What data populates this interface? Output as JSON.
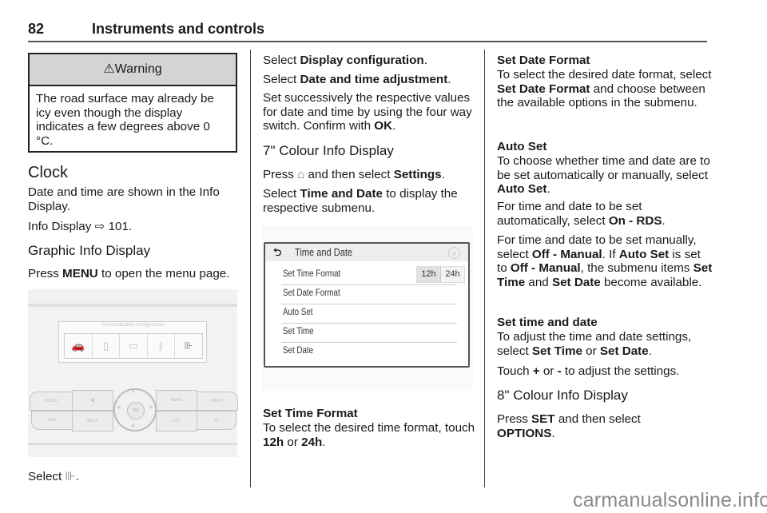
{
  "header": {
    "page_number": "82",
    "section_title": "Instruments and controls"
  },
  "warning": {
    "icon": "warning-triangle-icon",
    "icon_glyph": "⚠",
    "title": "Warning",
    "text": "The road surface may already be icy even though the display indicates a few degrees above 0 °C."
  },
  "col1": {
    "clock_heading": "Clock",
    "clock_text": "Date and time are shown in the Info Display.",
    "ref_prefix": "Info Display",
    "ref_arrow": "⇨",
    "ref_page": "101.",
    "graphic_heading": "Graphic Info Display",
    "press_prefix": "Press ",
    "press_bold": "MENU",
    "press_suffix": " to open the menu page.",
    "select_prefix": "Select ",
    "select_icon_glyph": "⊪",
    "select_suffix": "."
  },
  "panel_illustration": {
    "screen_title": "Personalisation-configuration",
    "icons": [
      "car-settings-icon",
      "phone-icon",
      "media-icon",
      "bluetooth-icon",
      "config-sliders-icon"
    ],
    "icon_glyphs": [
      "🚗",
      "▯",
      "▭",
      "ᛒ",
      "⊪"
    ],
    "buttons": {
      "audio": "AUDIO",
      "phone": "▣",
      "menu": "MENU",
      "band": "BAND",
      "src": "SRC",
      "back": "BACK",
      "list": "LIST",
      "ta": "TA",
      "ok": "OK"
    }
  },
  "col2": {
    "p1_prefix": "Select ",
    "p1_bold": "Display configuration",
    "p1_suffix": ".",
    "p2_prefix": "Select ",
    "p2_bold": "Date and time adjustment",
    "p2_suffix": ".",
    "p3_text": "Set successively the respective values for date and time by using the four way switch. Confirm with ",
    "p3_bold": "OK",
    "p3_suffix": ".",
    "heading_7": "7\" Colour Info Display",
    "p4_prefix": "Press ",
    "p4_icon_glyph": "⌂",
    "p4_mid": " and then select ",
    "p4_bold": "Settings",
    "p4_suffix": ".",
    "p5_prefix": "Select ",
    "p5_bold": "Time and Date",
    "p5_suffix": " to display the respective submenu.",
    "set_time_heading": "Set Time Format",
    "set_time_text": "To select the desired time format, touch ",
    "set_time_12": "12h",
    "set_time_or": " or ",
    "set_time_24": "24h",
    "set_time_end": "."
  },
  "screen_illustration": {
    "back_glyph": "⮌",
    "title": "Time and Date",
    "music_glyph": "♫",
    "rows": [
      "Set Time Format",
      "Set Date Format",
      "Auto Set",
      "Set Time",
      "Set Date"
    ],
    "format_options": [
      "12h",
      "24h"
    ]
  },
  "col3": {
    "date_fmt_heading": "Set Date Format",
    "date_fmt_a": "To select the desired date format, select ",
    "date_fmt_bold": "Set Date Format",
    "date_fmt_b": " and choose between the available options in the submenu.",
    "auto_heading": "Auto Set",
    "auto_a": "To choose whether time and date are to be set automatically or manually, select ",
    "auto_bold": "Auto Set",
    "auto_end": ".",
    "rds_a": "For time and date to be set automatically, select ",
    "rds_bold": "On - RDS",
    "rds_end": ".",
    "man_a": "For time and date to be set manually, select ",
    "man_b1": "Off - Manual",
    "man_c": ". If ",
    "man_b2": "Auto Set",
    "man_d": " is set to ",
    "man_b3": "Off - Manual",
    "man_e": ", the submenu items ",
    "man_b4": "Set Time",
    "man_f": " and ",
    "man_b5": "Set Date",
    "man_g": " become available.",
    "std_heading": "Set time and date",
    "std_a": "To adjust the time and date settings, select ",
    "std_b1": "Set Time",
    "std_or": " or ",
    "std_b2": "Set Date",
    "std_end": ".",
    "touch_a": "Touch ",
    "touch_plus": "+",
    "touch_or": " or ",
    "touch_minus": "-",
    "touch_end": " to adjust the settings.",
    "heading_8": "8\" Colour Info Display",
    "set_a": "Press ",
    "set_b": "SET",
    "set_c": " and then select ",
    "set_d": "OPTIONS",
    "set_e": "."
  },
  "watermark": "carmanualsonline.info"
}
